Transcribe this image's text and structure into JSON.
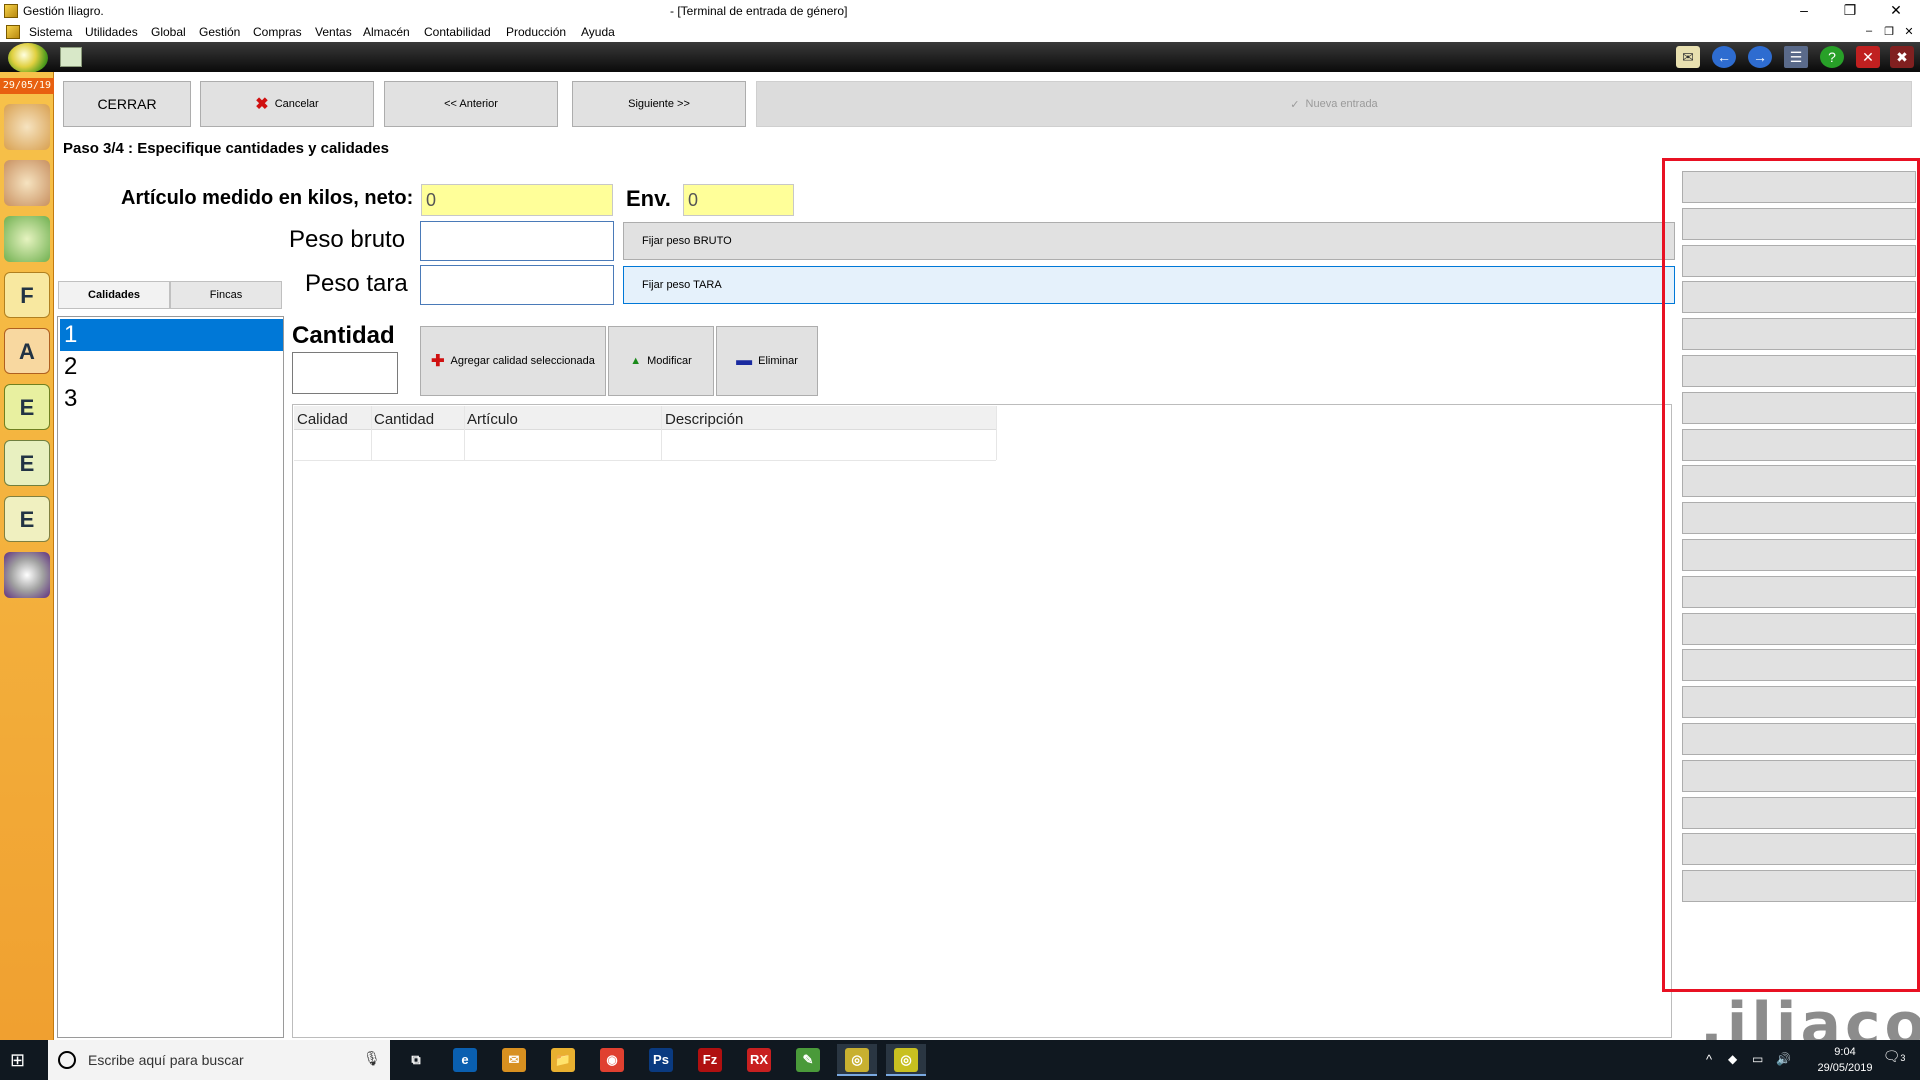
{
  "window": {
    "app_title": "Gestión Iliagro.",
    "document_title": "- [Terminal de entrada de género]",
    "minimize": "–",
    "restore": "❐",
    "close": "✕"
  },
  "menu": {
    "items": [
      "Sistema",
      "Utilidades",
      "Global",
      "Gestión",
      "Compras",
      "Ventas",
      "Almacén",
      "Contabilidad",
      "Producción",
      "Ayuda"
    ],
    "mdi_min": "–",
    "mdi_restore": "❐",
    "mdi_close": "✕"
  },
  "sidebar": {
    "date": "29/05/19",
    "icons": [
      "users-icon",
      "user-icon",
      "user-green-icon",
      "document-f-icon",
      "document-a-icon",
      "document-e-icon",
      "document-e2-icon",
      "document-e3-icon",
      "disc-wand-icon"
    ],
    "icon_letters": [
      "",
      "",
      "",
      "F",
      "A",
      "E",
      "E",
      "E",
      ""
    ]
  },
  "actions": {
    "close_label": "CERRAR",
    "cancel_label": "Cancelar",
    "previous_label": "<< Anterior",
    "next_label": "Siguiente >>",
    "new_entry_label": "Nueva entrada"
  },
  "step": {
    "title": "Paso 3/4 : Especifique cantidades y calidades"
  },
  "weights": {
    "net_label": "Artículo medido en kilos, neto:",
    "net_value": "0",
    "env_label": "Env.",
    "env_value": "0",
    "gross_label": "Peso bruto",
    "gross_value": "",
    "tare_label": "Peso tara",
    "tare_value": "",
    "set_gross_label": "Fijar peso BRUTO",
    "set_tare_label": "Fijar peso TARA"
  },
  "tabs": [
    {
      "label": "Calidades",
      "active": true
    },
    {
      "label": "Fincas",
      "active": false
    }
  ],
  "qualities": [
    {
      "label": "1",
      "selected": true
    },
    {
      "label": "2",
      "selected": false
    },
    {
      "label": "3",
      "selected": false
    }
  ],
  "quantity": {
    "label": "Cantidad",
    "value": "",
    "add_label": "Agregar calidad seleccionada",
    "modify_label": "Modificar",
    "delete_label": "Eliminar"
  },
  "grid": {
    "columns": [
      "Calidad",
      "Cantidad",
      "Artículo",
      "Descripción"
    ],
    "rows": []
  },
  "right_panel": {
    "button_count": 20
  },
  "logo": {
    "text": ".iliaco."
  },
  "taskbar": {
    "search_placeholder": "Escribe aquí para buscar",
    "time": "9:04",
    "date": "29/05/2019",
    "notifications": "3",
    "apps": [
      "task-view-icon",
      "edge-icon",
      "outlook-icon",
      "explorer-icon",
      "chrome-icon",
      "photoshop-icon",
      "filezilla-icon",
      "rx-icon",
      "notepad-icon",
      "iliagro-icon",
      "iliagro2-icon"
    ],
    "app_glyphs": [
      "⧉",
      "e",
      "✉",
      "📁",
      "◉",
      "Ps",
      "Fz",
      "RX",
      "✎",
      "◎",
      "◎"
    ]
  },
  "colors": {
    "selection": "#0078d7",
    "highlight_frame": "#e81123",
    "yellow_input": "#ffff99",
    "sidebar": "#f0a030"
  }
}
